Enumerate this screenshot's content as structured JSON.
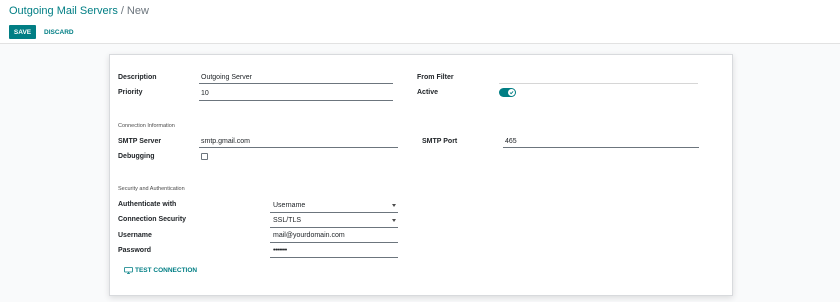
{
  "breadcrumb": {
    "parent": "Outgoing Mail Servers",
    "separator": "/",
    "current": "New"
  },
  "toolbar": {
    "save_label": "SAVE",
    "discard_label": "DISCARD"
  },
  "form": {
    "description": {
      "label": "Description",
      "value": "Outgoing Server"
    },
    "priority": {
      "label": "Priority",
      "value": "10"
    },
    "from_filter": {
      "label": "From Filter",
      "value": ""
    },
    "active": {
      "label": "Active",
      "value": true
    },
    "connection_section": "Connection Information",
    "smtp_server": {
      "label": "SMTP Server",
      "value": "smtp.gmail.com"
    },
    "smtp_port": {
      "label": "SMTP Port",
      "value": "465"
    },
    "debugging": {
      "label": "Debugging",
      "checked": false
    },
    "security_section": "Security and Authentication",
    "authenticate_with": {
      "label": "Authenticate with",
      "value": "Username"
    },
    "connection_security": {
      "label": "Connection Security",
      "value": "SSL/TLS"
    },
    "username": {
      "label": "Username",
      "value": "mail@yourdomain.com"
    },
    "password": {
      "label": "Password",
      "value": "•••••••"
    },
    "test_connection_label": "TEST CONNECTION"
  },
  "colors": {
    "accent": "#017e84",
    "background": "#f9fafb",
    "sheet": "#ffffff"
  },
  "icons": [
    "check-icon",
    "caret-down-icon",
    "monitor-icon"
  ]
}
